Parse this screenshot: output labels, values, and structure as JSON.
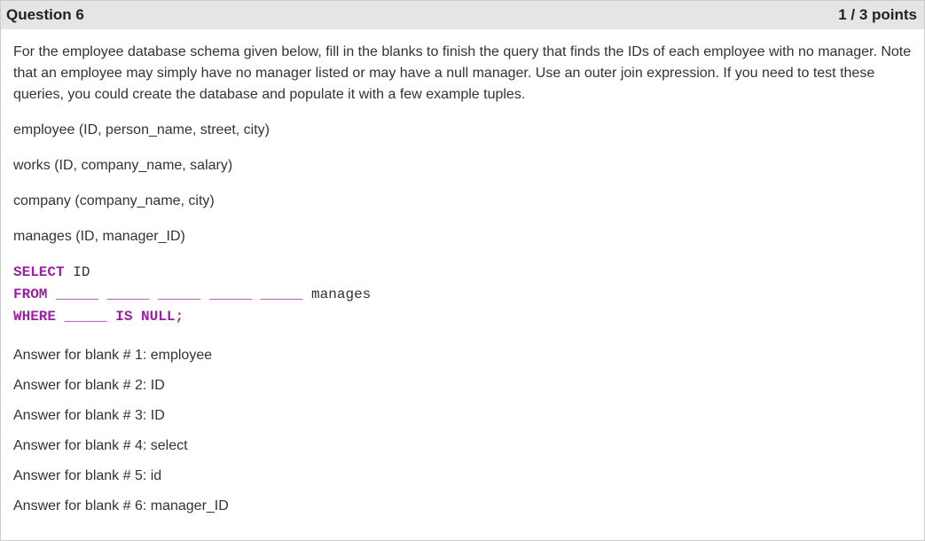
{
  "header": {
    "title": "Question 6",
    "points": "1 / 3 points"
  },
  "prompt": "For the employee database schema given below, fill in the blanks to finish the query that finds the IDs of each employee with no manager. Note that an employee may simply have no manager listed or may have a null manager.  Use an outer join expression.  If you need to test these queries, you could create the database and populate it with a few example tuples.",
  "schema": {
    "line1": "employee (ID, person_name, street, city)",
    "line2": "works (ID, company_name, salary)",
    "line3": "company (company_name, city)",
    "line4": "manages (ID, manager_ID)"
  },
  "code": {
    "kw_select": "SELECT",
    "select_col": " ID",
    "kw_from": "FROM",
    "blank_segment": " _____",
    "from_tail": " manages",
    "kw_where": "WHERE",
    "kw_is": " IS",
    "kw_null": " NULL",
    "semicolon": ";"
  },
  "answers": {
    "a1": "Answer for blank # 1: employee",
    "a2": "Answer for blank # 2: ID",
    "a3": "Answer for blank # 3: ID",
    "a4": "Answer for blank # 4: select",
    "a5": "Answer for blank # 5: id",
    "a6": "Answer for blank # 6: manager_ID"
  }
}
